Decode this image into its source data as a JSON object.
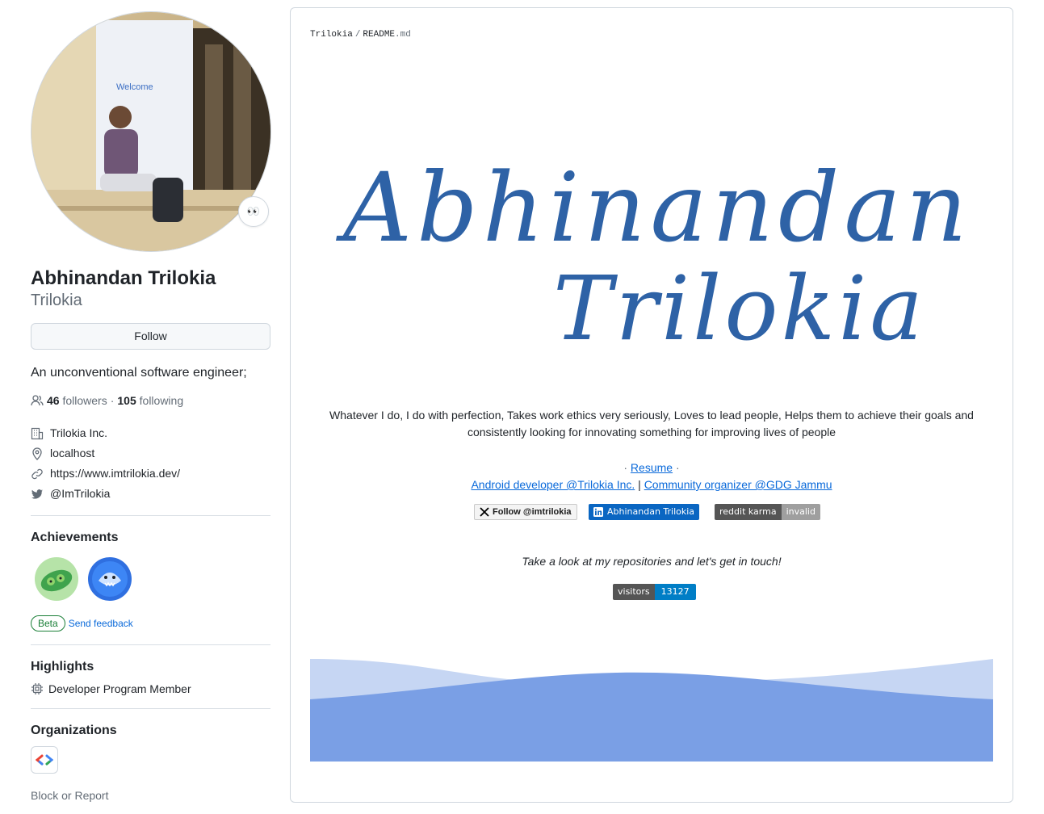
{
  "profile": {
    "fullname": "Abhinandan Trilokia",
    "username": "Trilokia",
    "status_emoji": "👀",
    "follow_label": "Follow",
    "bio": "An unconventional software engineer;",
    "followers_count": "46",
    "followers_label": "followers",
    "separator": "·",
    "following_count": "105",
    "following_label": "following",
    "company": "Trilokia Inc.",
    "location": "localhost",
    "website": "https://www.imtrilokia.dev/",
    "twitter": "@ImTrilokia"
  },
  "achievements": {
    "title": "Achievements",
    "items": [
      {
        "name": "pair-extraordinaire-icon"
      },
      {
        "name": "pull-shark-icon"
      }
    ],
    "beta_label": "Beta",
    "feedback_label": "Send feedback"
  },
  "highlights": {
    "title": "Highlights",
    "items": [
      {
        "label": "Developer Program Member"
      }
    ]
  },
  "organizations": {
    "title": "Organizations",
    "items": [
      {
        "name": "gdg-logo"
      }
    ]
  },
  "block_label": "Block or Report",
  "readme": {
    "path_owner": "Trilokia",
    "path_sep": "/",
    "path_file": "README",
    "path_ext": ".md",
    "signature_line1": "Abhinandan",
    "signature_line2": "Trilokia",
    "tagline": "Whatever I do, I do with perfection, Takes work ethics very seriously, Loves to lead people, Helps them to achieve their goals and consistently looking for innovating something for improving lives of people",
    "links1_prefix": "· ",
    "resume": "Resume",
    "links1_suffix": " ·",
    "android_link": "Android developer @Trilokia Inc.",
    "pipe": " | ",
    "community_link": "Community organizer @GDG Jammu",
    "badge_x": "Follow @imtrilokia",
    "badge_linkedin": "Abhinandan Trilokia",
    "badge_reddit_left": "reddit karma",
    "badge_reddit_right": "invalid",
    "cta": "Take a look at my repositories and let's get in touch!",
    "badge_visitors_left": "visitors",
    "badge_visitors_right": "13127",
    "colors": {
      "signature": "#2e62a6",
      "wave_light": "#c6d6f3",
      "wave_dark": "#7a9fe5",
      "link": "#0969da"
    }
  }
}
